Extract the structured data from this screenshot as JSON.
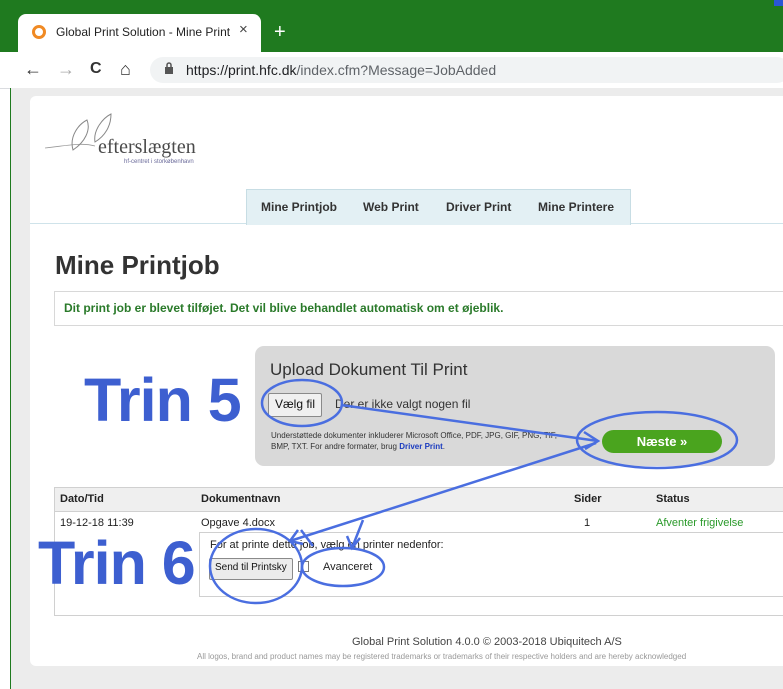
{
  "browser": {
    "tab_title": "Global Print Solution - Mine Print",
    "tab_close": "×",
    "new_tab": "+",
    "url_host": "https://print.hfc.dk",
    "url_path": "/index.cfm?Message=JobAdded",
    "nav": {
      "back": "←",
      "forward": "→",
      "reload": "C",
      "home": "⌂",
      "lock": "🔒"
    }
  },
  "logo": {
    "text": "efterslægten",
    "sub": "hf-centret i storkøbenhavn"
  },
  "nav_tabs": [
    "Mine Printjob",
    "Web Print",
    "Driver Print",
    "Mine Printere"
  ],
  "page_title": "Mine Printjob",
  "message": "Dit print job er blevet tilføjet. Det vil blive behandlet automatisk om et øjeblik.",
  "upload": {
    "title": "Upload Dokument Til Print",
    "choose_label": "Vælg fil",
    "no_file": "Der er ikke valgt nogen fil",
    "support_text": "Understøttede dokumenter inkluderer Microsoft Office, PDF, JPG, GIF, PNG, TIF, BMP, TXT. For andre formater, brug",
    "support_link": "Driver Print",
    "next_label": "Næste »"
  },
  "table": {
    "headers": [
      "Dato/Tid",
      "Dokumentnavn",
      "Sider",
      "Status"
    ],
    "rows": [
      {
        "date": "19-12-18 11:39",
        "doc": "Opgave 4.docx",
        "pages": "1",
        "status": "Afventer frigivelse"
      }
    ],
    "sub_note": "For at printe dette job, vælg en printer nedenfor:",
    "send_label": "Send til Printsky",
    "advanced_label": "Avanceret"
  },
  "footer": {
    "line1": "Global Print Solution 4.0.0 © 2003-2018 Ubiquitech A/S",
    "line2": "All logos, brand and product names may be registered trademarks or trademarks of their respective holders and are hereby acknowledged"
  },
  "annotations": {
    "step5": "Trin 5",
    "step6": "Trin 6",
    "color": "#3d5fd0"
  },
  "colors": {
    "browser_green": "#1f7a1f",
    "next_green": "#4aa41e",
    "status_green": "#2a9a2a",
    "message_green": "#2a7a2a"
  }
}
